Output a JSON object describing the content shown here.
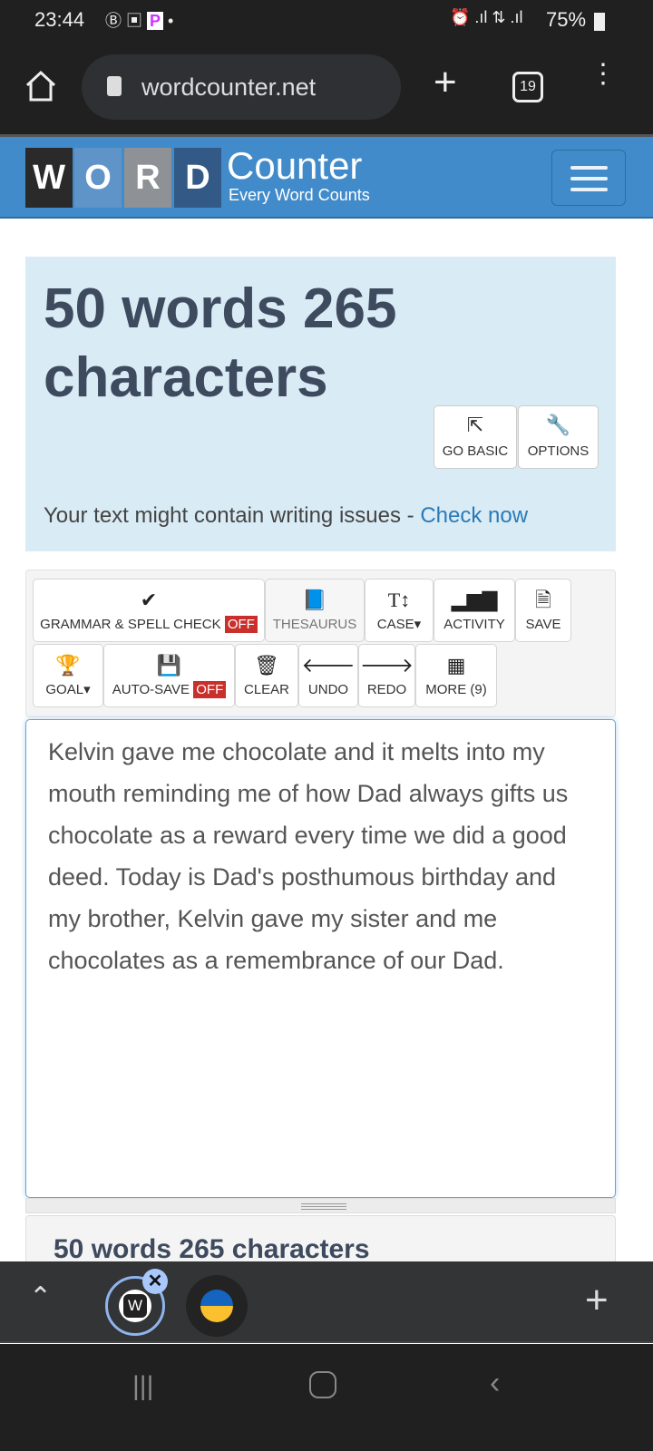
{
  "status": {
    "time": "23:44",
    "battery": "75%",
    "icons": [
      "bbm-icon",
      "gallery-icon",
      "p-app-icon",
      "dot-icon",
      "alarm-icon",
      "signal-icon",
      "hplus-data-icon",
      "signal-icon",
      "battery-icon"
    ]
  },
  "browser": {
    "url": "wordcounter.net",
    "tab_count": "19"
  },
  "logo": {
    "letters": [
      "W",
      "O",
      "R",
      "D"
    ],
    "name": "Counter",
    "tagline": "Every Word Counts"
  },
  "summary": {
    "title": "50 words 265 characters",
    "go_basic": "GO BASIC",
    "options": "OPTIONS",
    "issues_text": "Your text might contain writing issues - ",
    "issues_link": "Check now"
  },
  "toolbar": {
    "grammar": "GRAMMAR & SPELL CHECK",
    "grammar_state": "OFF",
    "thesaurus": "THESAURUS",
    "case": "CASE▾",
    "activity": "ACTIVITY",
    "save": "SAVE",
    "goal": "GOAL▾",
    "autosave": "AUTO-SAVE",
    "autosave_state": "OFF",
    "clear": "CLEAR",
    "undo": "UNDO",
    "redo": "REDO",
    "more": "MORE (9)"
  },
  "editor": {
    "text": "Kelvin gave me chocolate and it melts into my mouth reminding me of how Dad always gifts us chocolate as a reward every time we did a good deed. Today is Dad's posthumous birthday and my brother, Kelvin gave my sister and me chocolates as a remembrance of our Dad."
  },
  "details": {
    "title": "50 words 265 characters"
  },
  "colors": {
    "header": "#428bca",
    "summary_bg": "#d9ebf5",
    "off_badge": "#c9302c",
    "link": "#2a7ab8"
  }
}
